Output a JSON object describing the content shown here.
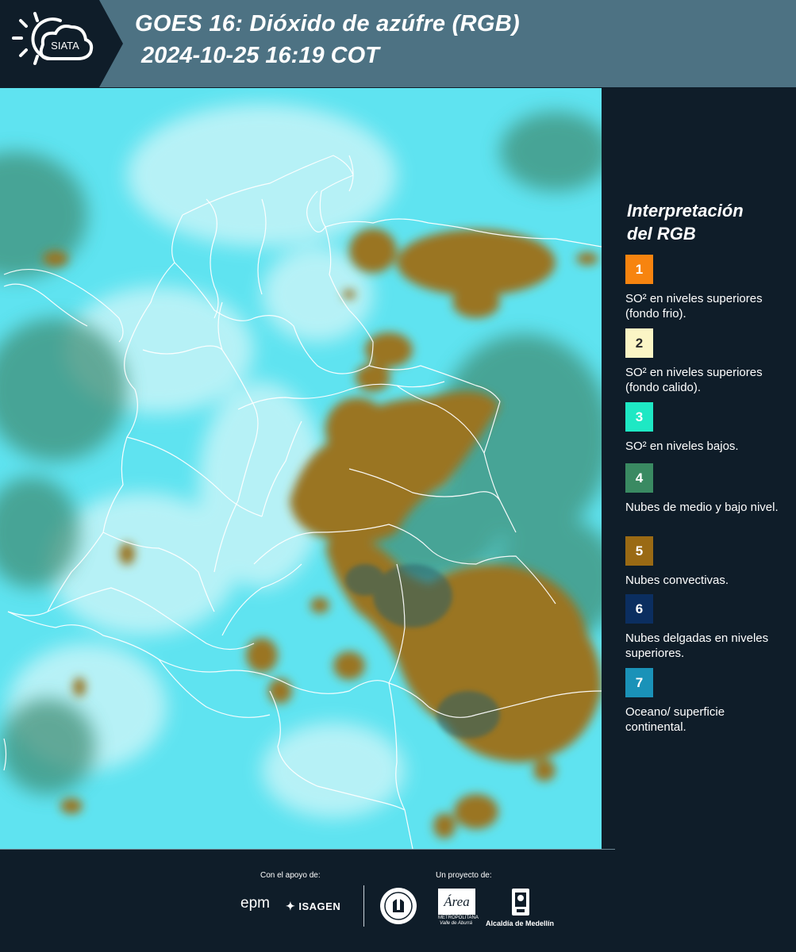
{
  "header": {
    "logo_text": "SIATA",
    "title_line1": "GOES 16: Dióxido de azúfre (RGB)",
    "title_line2": "2024-10-25 16:19 COT"
  },
  "legend": {
    "title_line1": "Interpretación",
    "title_line2": "del RGB",
    "items": [
      {
        "number": "1",
        "color": "#f7840f",
        "text": "SO² en niveles superiores (fondo frio)."
      },
      {
        "number": "2",
        "color": "#fbf5c5",
        "text": "SO² en niveles superiores (fondo calido)."
      },
      {
        "number": "3",
        "color": "#1ee8c4",
        "text": "SO² en niveles bajos."
      },
      {
        "number": "4",
        "color": "#3a8a62",
        "text": "Nubes de medio y bajo nivel."
      },
      {
        "number": "5",
        "color": "#9a6a14",
        "text": "Nubes convectivas."
      },
      {
        "number": "6",
        "color": "#0b2e60",
        "text": "Nubes delgadas en niveles superiores."
      },
      {
        "number": "7",
        "color": "#1a92b8",
        "text": "Oceano/ superficie continental."
      }
    ]
  },
  "footer": {
    "support_label": "Con el apoyo de:",
    "project_label": "Un proyecto de:",
    "sponsor_epm": "epm",
    "sponsor_isagen": "ISAGEN",
    "partner_area": "Área",
    "partner_area_sub1": "METROPOLITANA",
    "partner_area_sub2": "Valle de Aburrá",
    "partner_alcaldia": "Alcaldía de Medellín"
  },
  "map": {
    "colors": {
      "background": "#5fe3f0",
      "cloud_brown": "#9a7424",
      "cloud_green": "#3e8a70",
      "cloud_dark_edge": "#2c5f66",
      "white_cloud": "#c6f4f8",
      "borders": "#ffffff"
    }
  }
}
